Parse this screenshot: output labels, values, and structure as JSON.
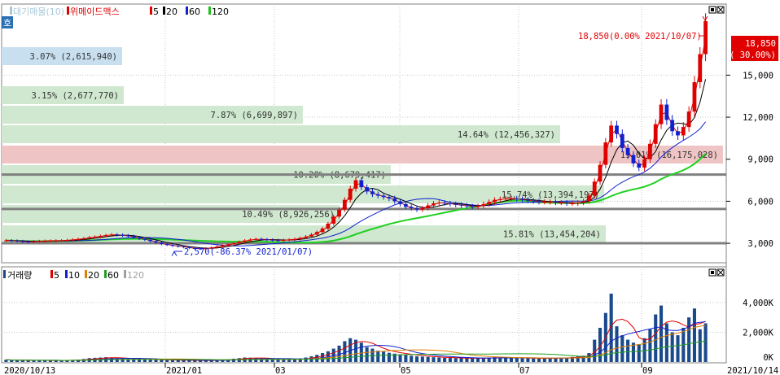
{
  "top_legend": {
    "tag": "호",
    "items": [
      {
        "label": "대기매물(10)",
        "color": "#a8c8d8"
      },
      {
        "label": "위메이드맥스",
        "color": "#e00000"
      },
      {
        "label": "5",
        "color": "#e00000"
      },
      {
        "label": "20",
        "color": "#000000"
      },
      {
        "label": "60",
        "color": "#1020d0"
      },
      {
        "label": "120",
        "color": "#20c020"
      }
    ]
  },
  "volume_legend": {
    "items": [
      {
        "label": "거래량",
        "color": "#1a4a8a"
      },
      {
        "label": "5",
        "color": "#e00000"
      },
      {
        "label": "10",
        "color": "#1020d0"
      },
      {
        "label": "20",
        "color": "#e08000"
      },
      {
        "label": "60",
        "color": "#20a020"
      },
      {
        "label": "120",
        "color": "#a0a0a0"
      }
    ]
  },
  "price_labels": {
    "current_price": "18,850",
    "current_change": "( 30.00%)",
    "high_annotation": "18,850(0.00% 2021/10/07)",
    "low_annotation": "2,570(-86.37% 2021/01/07)"
  },
  "chart_data": {
    "type": "candlestick",
    "price_axis": {
      "ticks": [
        "3,000",
        "6,000",
        "9,000",
        "12,000",
        "15,000"
      ],
      "values": [
        3000,
        6000,
        9000,
        12000,
        15000
      ],
      "range": [
        1900,
        19900
      ]
    },
    "volume_axis": {
      "ticks": [
        "0K",
        "2,000K",
        "4,000K"
      ],
      "values": [
        0,
        2000,
        4000
      ],
      "range": [
        0,
        5200
      ]
    },
    "date_axis": {
      "ticks": [
        "2020/10/13",
        "2021/01",
        "03",
        "05",
        "07",
        "09",
        "2021/10/14"
      ]
    },
    "volume_profile": [
      {
        "label": "3.07% (2,615,940)",
        "pct": 3.07
      },
      {
        "label": "3.15% (2,677,770)",
        "pct": 3.15
      },
      {
        "label": "7.87% (6,699,897)",
        "pct": 7.87
      },
      {
        "label": "14.64% (12,456,327)",
        "pct": 14.64
      },
      {
        "label": "19.01% (16,175,028)",
        "pct": 19.01
      },
      {
        "label": "10.20% (8,679,417)",
        "pct": 10.2
      },
      {
        "label": "15.74% (13,394,197)",
        "pct": 15.74
      },
      {
        "label": "10.49% (8,926,256)",
        "pct": 10.49
      },
      {
        "label": "15.81% (13,454,204)",
        "pct": 15.81
      }
    ],
    "horizontal_lines": [
      7900,
      5450,
      3000
    ],
    "high": {
      "value": 18850,
      "date": "2021/10/07"
    },
    "low": {
      "value": 2570,
      "date": "2021/01/07"
    },
    "price_series": [
      [
        3200,
        150
      ],
      [
        3180,
        120
      ],
      [
        3150,
        110
      ],
      [
        3120,
        130
      ],
      [
        3100,
        100
      ],
      [
        3130,
        90
      ],
      [
        3150,
        120
      ],
      [
        3170,
        100
      ],
      [
        3180,
        110
      ],
      [
        3190,
        95
      ],
      [
        3200,
        100
      ],
      [
        3220,
        120
      ],
      [
        3260,
        140
      ],
      [
        3300,
        160
      ],
      [
        3350,
        200
      ],
      [
        3420,
        260
      ],
      [
        3460,
        280
      ],
      [
        3520,
        300
      ],
      [
        3580,
        320
      ],
      [
        3620,
        280
      ],
      [
        3600,
        240
      ],
      [
        3560,
        220
      ],
      [
        3500,
        200
      ],
      [
        3420,
        190
      ],
      [
        3330,
        180
      ],
      [
        3250,
        170
      ],
      [
        3150,
        160
      ],
      [
        3050,
        150
      ],
      [
        2950,
        140
      ],
      [
        2880,
        130
      ],
      [
        2820,
        120
      ],
      [
        2780,
        110
      ],
      [
        2720,
        120
      ],
      [
        2660,
        110
      ],
      [
        2620,
        100
      ],
      [
        2600,
        90
      ],
      [
        2640,
        100
      ],
      [
        2700,
        120
      ],
      [
        2760,
        130
      ],
      [
        2840,
        150
      ],
      [
        2920,
        180
      ],
      [
        3000,
        220
      ],
      [
        3100,
        260
      ],
      [
        3200,
        300
      ],
      [
        3260,
        290
      ],
      [
        3300,
        260
      ],
      [
        3280,
        230
      ],
      [
        3250,
        200
      ],
      [
        3220,
        180
      ],
      [
        3200,
        170
      ],
      [
        3230,
        160
      ],
      [
        3260,
        170
      ],
      [
        3300,
        190
      ],
      [
        3380,
        240
      ],
      [
        3480,
        300
      ],
      [
        3620,
        380
      ],
      [
        3800,
        480
      ],
      [
        4050,
        600
      ],
      [
        4400,
        720
      ],
      [
        4900,
        900
      ],
      [
        5400,
        1100
      ],
      [
        6100,
        1400
      ],
      [
        6900,
        1600
      ],
      [
        7500,
        1500
      ],
      [
        7000,
        1300
      ],
      [
        6700,
        1000
      ],
      [
        6500,
        900
      ],
      [
        6400,
        760
      ],
      [
        6300,
        700
      ],
      [
        6200,
        620
      ],
      [
        6000,
        560
      ],
      [
        5800,
        520
      ],
      [
        5600,
        480
      ],
      [
        5500,
        420
      ],
      [
        5400,
        380
      ],
      [
        5500,
        360
      ],
      [
        5700,
        340
      ],
      [
        5850,
        320
      ],
      [
        5900,
        300
      ],
      [
        5850,
        280
      ],
      [
        5800,
        270
      ],
      [
        5750,
        260
      ],
      [
        5700,
        250
      ],
      [
        5650,
        240
      ],
      [
        5600,
        240
      ],
      [
        5650,
        260
      ],
      [
        5800,
        280
      ],
      [
        5950,
        300
      ],
      [
        6100,
        320
      ],
      [
        6150,
        300
      ],
      [
        6200,
        290
      ],
      [
        6200,
        280
      ],
      [
        6150,
        270
      ],
      [
        6100,
        260
      ],
      [
        6050,
        250
      ],
      [
        6000,
        240
      ],
      [
        5950,
        240
      ],
      [
        5950,
        250
      ],
      [
        5950,
        260
      ],
      [
        5900,
        270
      ],
      [
        5900,
        280
      ],
      [
        5850,
        300
      ],
      [
        5850,
        340
      ],
      [
        5900,
        380
      ],
      [
        6000,
        420
      ],
      [
        6400,
        600
      ],
      [
        7400,
        1500
      ],
      [
        8600,
        2300
      ],
      [
        10200,
        3300
      ],
      [
        11400,
        4600
      ],
      [
        10800,
        2400
      ],
      [
        9800,
        1800
      ],
      [
        9300,
        1500
      ],
      [
        8700,
        1300
      ],
      [
        8400,
        1200
      ],
      [
        9000,
        1600
      ],
      [
        10100,
        2200
      ],
      [
        11500,
        3200
      ],
      [
        12900,
        3800
      ],
      [
        11800,
        2600
      ],
      [
        11000,
        2000
      ],
      [
        10700,
        1800
      ],
      [
        11300,
        2300
      ],
      [
        12400,
        3000
      ],
      [
        14500,
        3600
      ],
      [
        16500,
        2200
      ],
      [
        18850,
        2600
      ]
    ]
  }
}
